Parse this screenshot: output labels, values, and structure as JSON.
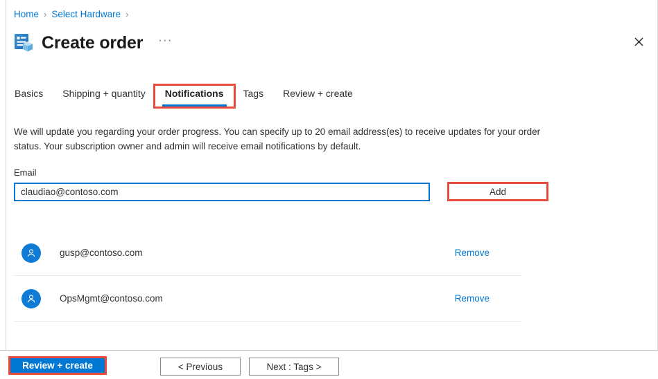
{
  "breadcrumb": {
    "items": [
      {
        "label": "Home",
        "separator": "›"
      },
      {
        "label": "Select Hardware",
        "separator": "›"
      }
    ]
  },
  "header": {
    "title": "Create order",
    "icon": "order-form-box-icon",
    "ellipsis": "···",
    "close_icon": "✕"
  },
  "tabs": [
    {
      "label": "Basics",
      "active": false
    },
    {
      "label": "Shipping + quantity",
      "active": false
    },
    {
      "label": "Notifications",
      "active": true,
      "highlighted": true
    },
    {
      "label": "Tags",
      "active": false
    },
    {
      "label": "Review + create",
      "active": false
    }
  ],
  "main": {
    "description": "We will update you regarding your order progress. You can specify up to 20 email address(es) to receive updates for your order status. Your subscription owner and admin will receive email notifications by default.",
    "email_label": "Email",
    "email_value": "claudiao@contoso.com",
    "email_placeholder": "",
    "add_label": "Add",
    "remove_label": "Remove",
    "recipients": [
      {
        "email": "gusp@contoso.com",
        "avatar": "person-avatar-icon"
      },
      {
        "email": "OpsMgmt@contoso.com",
        "avatar": "person-avatar-icon"
      }
    ]
  },
  "footer": {
    "review_create_label": "Review + create",
    "previous_label": "< Previous",
    "next_label": "Next : Tags >"
  },
  "colors": {
    "accent_blue": "#0078d4",
    "highlight_red": "#e74c3c",
    "link_blue": "#0078d4",
    "text": "#323130",
    "divider": "#edebe9"
  }
}
